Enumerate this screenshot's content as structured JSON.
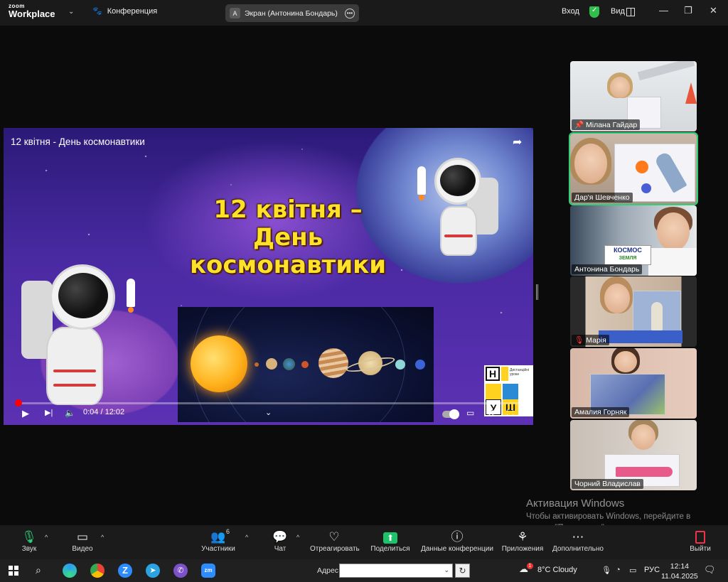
{
  "titlebar": {
    "logo_line1": "zoom",
    "logo_line2": "Workplace",
    "meeting_label": "Конференция",
    "share_avatar": "A",
    "share_label": "Экран (Антонина Бондарь)",
    "login": "Вход",
    "view": "Вид",
    "minimize": "—",
    "restore": "❐",
    "close": "✕"
  },
  "video": {
    "title": "12 квітня - День космонавтики",
    "headline": [
      "12 квітня –",
      "День",
      "космонавтики"
    ],
    "time": "0:04 / 12:02",
    "progress_fraction": 0.0055,
    "nush_letters": [
      "Н",
      "У",
      "Ш"
    ],
    "nush_caption": "Дистанційні уроки"
  },
  "participants": [
    {
      "name": "Мілана Гайдар",
      "pinned": true
    },
    {
      "name": "Дар'я Шевченко",
      "active": true
    },
    {
      "name": "Антонина Бондарь"
    },
    {
      "name": "Марія",
      "muted": true
    },
    {
      "name": "Амалия Горняк"
    },
    {
      "name": "Чорний Владислав"
    }
  ],
  "sign_text": [
    "КОСМОС",
    "ЗЕМЛЯ"
  ],
  "watermark": {
    "title": "Активация Windows",
    "text": "Чтобы активировать Windows, перейдите в раздел \"Параметры\"."
  },
  "toolbar": {
    "audio": "Звук",
    "video": "Видео",
    "participants": "Участники",
    "participants_count": "6",
    "chat": "Чат",
    "react": "Отреагировать",
    "share": "Поделиться",
    "info": "Данные конференции",
    "apps": "Приложения",
    "more": "Дополнительно",
    "leave": "Выйти"
  },
  "taskbar": {
    "address_label": "Адрес",
    "weather": "8°C  Cloudy",
    "lang": "РУС",
    "time": "12:14",
    "date": "11.04.2025",
    "weather_badge": "1"
  },
  "colors": {
    "zoom_green": "#2fd07a",
    "share_green": "#1ec26a",
    "progress_red": "#ff0000",
    "headline_yellow": "#ffe12a"
  }
}
